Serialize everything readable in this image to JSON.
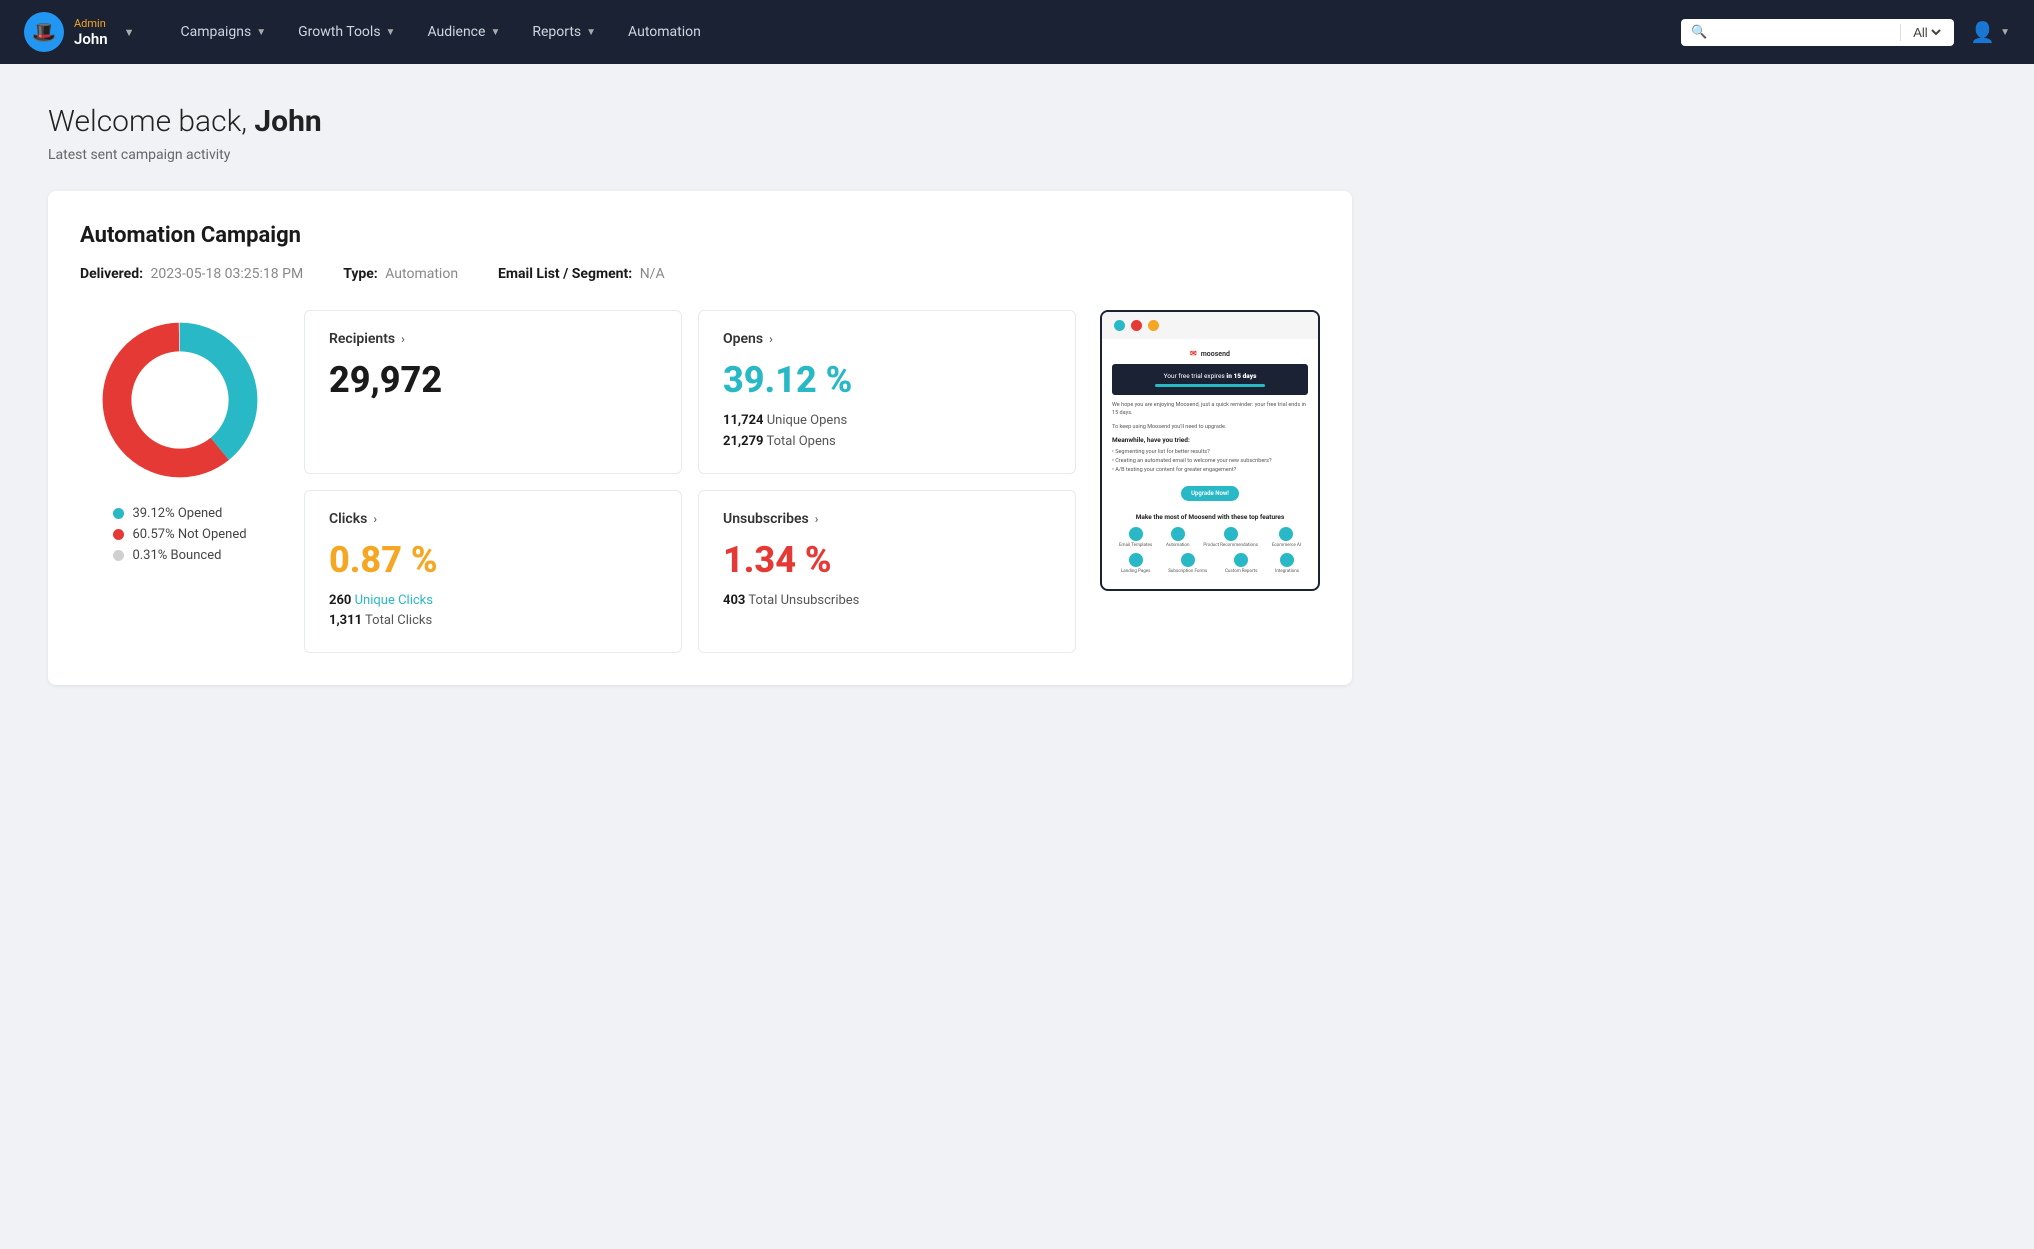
{
  "navbar": {
    "admin_label": "Admin",
    "username": "John",
    "nav_items": [
      {
        "label": "Campaigns",
        "has_arrow": true
      },
      {
        "label": "Growth Tools",
        "has_arrow": true
      },
      {
        "label": "Audience",
        "has_arrow": true
      },
      {
        "label": "Reports",
        "has_arrow": true
      },
      {
        "label": "Automation",
        "has_arrow": false
      }
    ],
    "search_placeholder": "",
    "search_filter": "All"
  },
  "page": {
    "welcome_prefix": "Welcome back, ",
    "welcome_name": "John",
    "subtitle": "Latest sent campaign activity"
  },
  "campaign": {
    "title": "Automation Campaign",
    "delivered_label": "Delivered:",
    "delivered_value": "2023-05-18 03:25:18 PM",
    "type_label": "Type:",
    "type_value": "Automation",
    "segment_label": "Email List / Segment:",
    "segment_value": "N/A",
    "donut": {
      "opened_pct": 39.12,
      "not_opened_pct": 60.57,
      "bounced_pct": 0.31,
      "opened_color": "#29b8c5",
      "not_opened_color": "#e53935",
      "bounced_color": "#d0d0d0",
      "legend": [
        {
          "label": "39.12% Opened",
          "color": "#29b8c5"
        },
        {
          "label": "60.57% Not Opened",
          "color": "#e53935"
        },
        {
          "label": "0.31% Bounced",
          "color": "#d0d0d0"
        }
      ]
    },
    "stats": {
      "recipients": {
        "label": "Recipients",
        "value": "29,972",
        "value_class": "dark"
      },
      "opens": {
        "label": "Opens",
        "value": "39.12 %",
        "value_class": "teal",
        "unique_opens": "11,724",
        "unique_opens_label": "Unique Opens",
        "total_opens": "21,279",
        "total_opens_label": "Total Opens"
      },
      "clicks": {
        "label": "Clicks",
        "value": "0.87 %",
        "value_class": "gold",
        "unique_clicks": "260",
        "unique_clicks_label": "Unique Clicks",
        "total_clicks": "1,311",
        "total_clicks_label": "Total Clicks"
      },
      "unsubscribes": {
        "label": "Unsubscribes",
        "value": "1.34 %",
        "value_class": "red",
        "total_unsubscribes": "403",
        "total_unsubscribes_label": "Total Unsubscribes"
      }
    }
  },
  "email_preview": {
    "titlebar_dots": [
      "teal",
      "red",
      "yellow"
    ],
    "brand": "moosend",
    "banner_text": "Your free trial expires in 15 days",
    "body_text1": "We hope you are enjoying Moosend, just a quick reminder: your free trial ends in 15 days.",
    "body_text2": "To keep using Moosend you'll need to upgrade.",
    "heading": "Meanwhile, have you tried:",
    "list_items": [
      "• Segmenting your list for better results?",
      "• Creating an automated email to welcome your new subscribers?",
      "• A/B testing your content for greater engagement?"
    ],
    "cta_button": "Upgrade Now!",
    "footer_heading": "Make the most of Moosend with these top features",
    "feature_icons": [
      "Email Templates",
      "Automation",
      "Product Recommendations",
      "Ecommerce AI",
      "Landing Pages",
      "Subscription Forms",
      "Custom Reports",
      "Integrations"
    ]
  }
}
